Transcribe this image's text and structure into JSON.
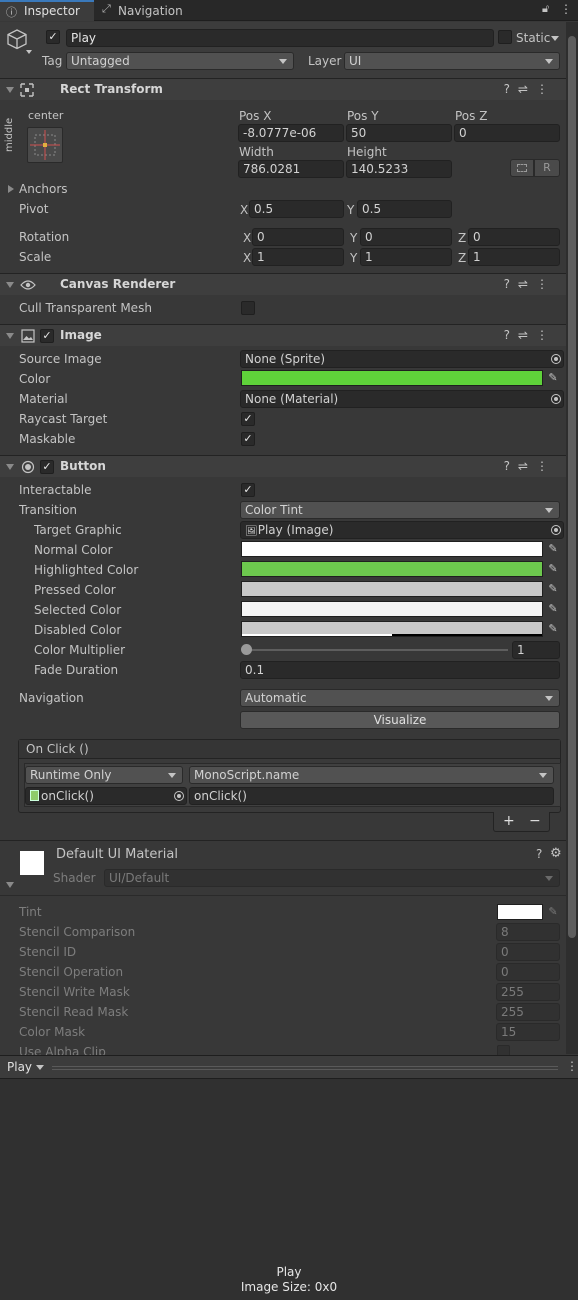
{
  "tabs": {
    "inspector": "Inspector",
    "navigation": "Navigation"
  },
  "object": {
    "name": "Play",
    "static_label": "Static",
    "tag_label": "Tag",
    "tag_value": "Untagged",
    "layer_label": "Layer",
    "layer_value": "UI"
  },
  "rect_transform": {
    "title": "Rect Transform",
    "anchor_h": "center",
    "anchor_v": "middle",
    "pos_x_label": "Pos X",
    "pos_x": "-8.0777e-06",
    "pos_y_label": "Pos Y",
    "pos_y": "50",
    "pos_z_label": "Pos Z",
    "pos_z": "0",
    "width_label": "Width",
    "width": "786.0281",
    "height_label": "Height",
    "height": "140.5233",
    "r_button": "R",
    "anchors_label": "Anchors",
    "pivot_label": "Pivot",
    "pivot_x": "0.5",
    "pivot_y": "0.5",
    "rotation_label": "Rotation",
    "rot_x": "0",
    "rot_y": "0",
    "rot_z": "0",
    "scale_label": "Scale",
    "scale_x": "1",
    "scale_y": "1",
    "scale_z": "1",
    "x": "X",
    "y": "Y",
    "z": "Z"
  },
  "canvas_renderer": {
    "title": "Canvas Renderer",
    "cull_label": "Cull Transparent Mesh"
  },
  "image": {
    "title": "Image",
    "source_label": "Source Image",
    "source_value": "None (Sprite)",
    "color_label": "Color",
    "color": "#5fd23a",
    "material_label": "Material",
    "material_value": "None (Material)",
    "raycast_label": "Raycast Target",
    "maskable_label": "Maskable"
  },
  "button": {
    "title": "Button",
    "interactable_label": "Interactable",
    "transition_label": "Transition",
    "transition_value": "Color Tint",
    "target_label": "Target Graphic",
    "target_value": "Play (Image)",
    "normal_label": "Normal Color",
    "highlighted_label": "Highlighted Color",
    "pressed_label": "Pressed Color",
    "selected_label": "Selected Color",
    "disabled_label": "Disabled Color",
    "multiplier_label": "Color Multiplier",
    "multiplier_value": "1",
    "fade_label": "Fade Duration",
    "fade_value": "0.1",
    "navigation_label": "Navigation",
    "navigation_value": "Automatic",
    "visualize_label": "Visualize",
    "colors": {
      "normal": "#ffffff",
      "highlighted": "#6dc84e",
      "pressed": "#c8c8c8",
      "selected": "#f5f5f5",
      "disabled": "#c8c8c8"
    }
  },
  "onclick": {
    "title": "On Click ()",
    "runtime_value": "Runtime Only",
    "function_value": "MonoScript.name",
    "object_value": "onClick()",
    "method_value": "onClick()",
    "plus": "+",
    "minus": "−"
  },
  "material": {
    "title": "Default UI Material",
    "shader_label": "Shader",
    "shader_value": "UI/Default",
    "tint_label": "Tint",
    "stencil_comp_label": "Stencil Comparison",
    "stencil_comp": "8",
    "stencil_id_label": "Stencil ID",
    "stencil_id": "0",
    "stencil_op_label": "Stencil Operation",
    "stencil_op": "0",
    "stencil_write_label": "Stencil Write Mask",
    "stencil_write": "255",
    "stencil_read_label": "Stencil Read Mask",
    "stencil_read": "255",
    "color_mask_label": "Color Mask",
    "color_mask": "15",
    "alpha_clip_label": "Use Alpha Clip"
  },
  "preview": {
    "dropdown": "Play",
    "name": "Play",
    "size": "Image Size: 0x0"
  }
}
